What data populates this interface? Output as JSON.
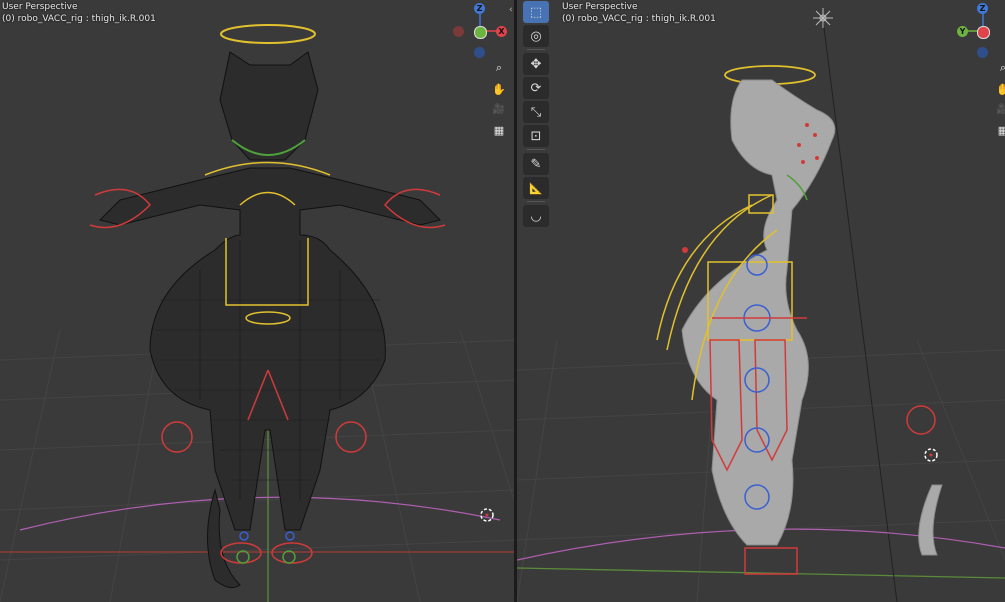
{
  "left_viewport": {
    "title": "User Perspective",
    "subtitle": "(0) robo_VACC_rig : thigh_ik.R.001",
    "gizmo": {
      "z": "Z",
      "x": "X"
    },
    "nav_icons": [
      "zoom-icon",
      "hand-pan-icon",
      "camera-icon",
      "grid-ortho-icon"
    ]
  },
  "right_viewport": {
    "title": "User Perspective",
    "subtitle": "(0) robo_VACC_rig : thigh_ik.R.001",
    "gizmo": {
      "z": "Z",
      "y": "Y"
    },
    "nav_icons": [
      "zoom-icon",
      "hand-pan-icon",
      "camera-icon",
      "grid-ortho-icon"
    ]
  },
  "toolbar": {
    "tools": [
      "select-box-icon",
      "cursor-icon",
      "move-icon",
      "rotate-icon",
      "scale-icon",
      "transform-icon",
      "annotate-icon",
      "measure-icon",
      "bone-roll-icon"
    ]
  },
  "colors": {
    "viewport_bg": "#3a3a3a",
    "gizmo_x": "#e0434a",
    "gizmo_y": "#6db33f",
    "gizmo_z": "#3f78d6",
    "active_tool": "#4772b3",
    "bone_yellow": "#e2c12e",
    "bone_red": "#d23a3a",
    "bone_blue": "#3a5fd2"
  },
  "glyphs": {
    "zoom": "⌕",
    "hand": "✋",
    "camera": "🎥",
    "grid": "▦",
    "select": "⬚",
    "cursor": "◎",
    "move": "✥",
    "rotate": "⟳",
    "scale": "⤡",
    "transform": "⊡",
    "annotate": "✎",
    "measure": "📐",
    "roll": "◡",
    "collapse": "‹"
  }
}
